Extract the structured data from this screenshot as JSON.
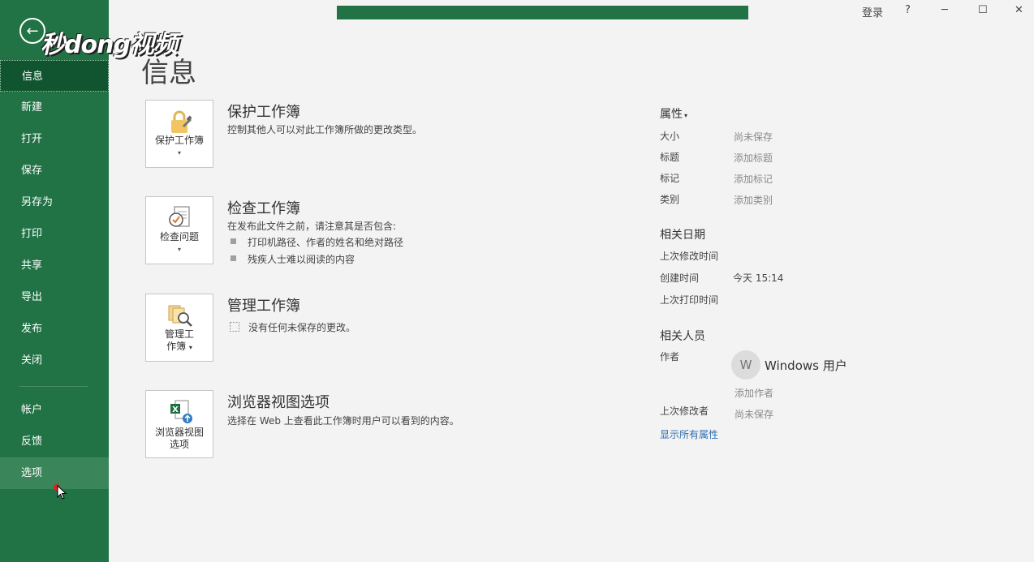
{
  "watermark": "秒dong视频",
  "nav": {
    "items": [
      "信息",
      "新建",
      "打开",
      "保存",
      "另存为",
      "打印",
      "共享",
      "导出",
      "发布",
      "关闭"
    ],
    "bottom_items": [
      "帐户",
      "反馈",
      "选项"
    ]
  },
  "titlebar": {
    "login": "登录",
    "help": "?",
    "minimize": "─",
    "maximize": "☐",
    "close": "✕"
  },
  "page_title": "信息",
  "sections": [
    {
      "tile_label": "保护工作簿",
      "title": "保护工作簿",
      "desc": "控制其他人可以对此工作簿所做的更改类型。"
    },
    {
      "tile_label": "检查问题",
      "title": "检查工作簿",
      "desc": "在发布此文件之前，请注意其是否包含:",
      "bullets": [
        "打印机路径、作者的姓名和绝对路径",
        "残疾人士难以阅读的内容"
      ]
    },
    {
      "tile_label_1": "管理工",
      "tile_label_2": "作簿",
      "title": "管理工作簿",
      "desc": "没有任何未保存的更改。"
    },
    {
      "tile_label_1": "浏览器视图",
      "tile_label_2": "选项",
      "title": "浏览器视图选项",
      "desc": "选择在 Web 上查看此工作簿时用户可以看到的内容。"
    }
  ],
  "properties": {
    "heading": "属性",
    "rows": [
      {
        "label": "大小",
        "value": "尚未保存"
      },
      {
        "label": "标题",
        "value": "添加标题"
      },
      {
        "label": "标记",
        "value": "添加标记"
      },
      {
        "label": "类别",
        "value": "添加类别"
      }
    ]
  },
  "dates": {
    "heading": "相关日期",
    "rows": [
      {
        "label": "上次修改时间",
        "value": ""
      },
      {
        "label": "创建时间",
        "value": "今天 15:14"
      },
      {
        "label": "上次打印时间",
        "value": ""
      }
    ]
  },
  "people": {
    "heading": "相关人员",
    "author_label": "作者",
    "avatar_initial": "W",
    "author_name": "Windows 用户",
    "add_author": "添加作者",
    "last_modified_by_label": "上次修改者",
    "last_modified_by_value": "尚未保存"
  },
  "show_all": "显示所有属性",
  "icons": {
    "back": "arrow-left-icon",
    "lock": "lock-icon",
    "inspect": "inspect-icon",
    "manage": "manage-icon",
    "browser": "excel-browser-icon"
  },
  "colors": {
    "sidebar": "#217346",
    "active": "#10552f",
    "link": "#2b6cb0"
  }
}
